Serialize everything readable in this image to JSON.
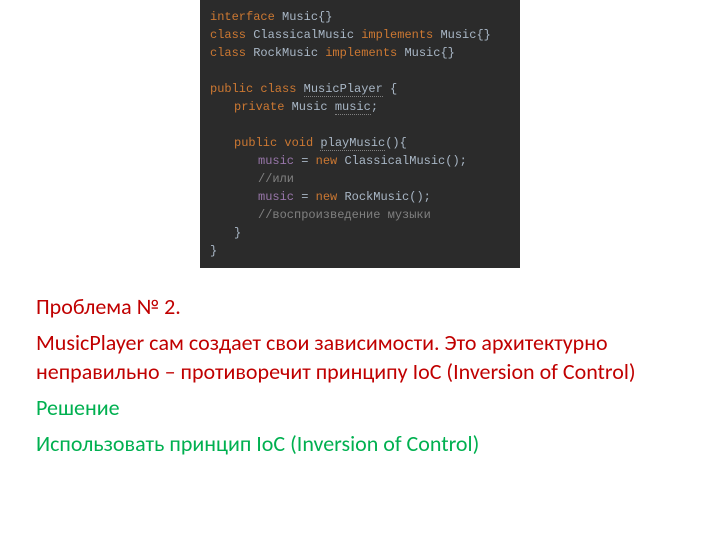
{
  "code": {
    "l1_kw1": "interface",
    "l1_name": " Music",
    "l1_brace": "{}",
    "l2_kw1": "class",
    "l2_name": " ClassicalMusic ",
    "l2_kw2": "implements",
    "l2_iface": " Music",
    "l2_brace": "{}",
    "l3_kw1": "class",
    "l3_name": " RockMusic ",
    "l3_kw2": "implements",
    "l3_iface": " Music",
    "l3_brace": "{}",
    "l5_kw1": "public class ",
    "l5_name": "MusicPlayer",
    "l5_brace": " {",
    "l6_kw1": "private ",
    "l6_type": "Music ",
    "l6_field": "music",
    "l6_semi": ";",
    "l8_kw1": "public void ",
    "l8_name": "playMusic",
    "l8_paren": "(){",
    "l9_field": "music",
    "l9_eq": " = ",
    "l9_kw": "new ",
    "l9_new": "ClassicalMusic();",
    "l10_cmt": "//или",
    "l11_field": "music",
    "l11_eq": " = ",
    "l11_kw": "new ",
    "l11_new": "RockMusic();",
    "l12_cmt": "//воспроизведение музыки",
    "l13_brace": "}",
    "l14_brace": "}"
  },
  "text": {
    "problem_title": "Проблема № 2.",
    "problem_body": "MusicPlayer сам создает свои зависимости. Это архитектурно неправильно – противоречит принципу IoC (Inversion of Control)",
    "solution_title": "Решение",
    "solution_body": "Использовать принцип IoC (Inversion of Control)"
  }
}
